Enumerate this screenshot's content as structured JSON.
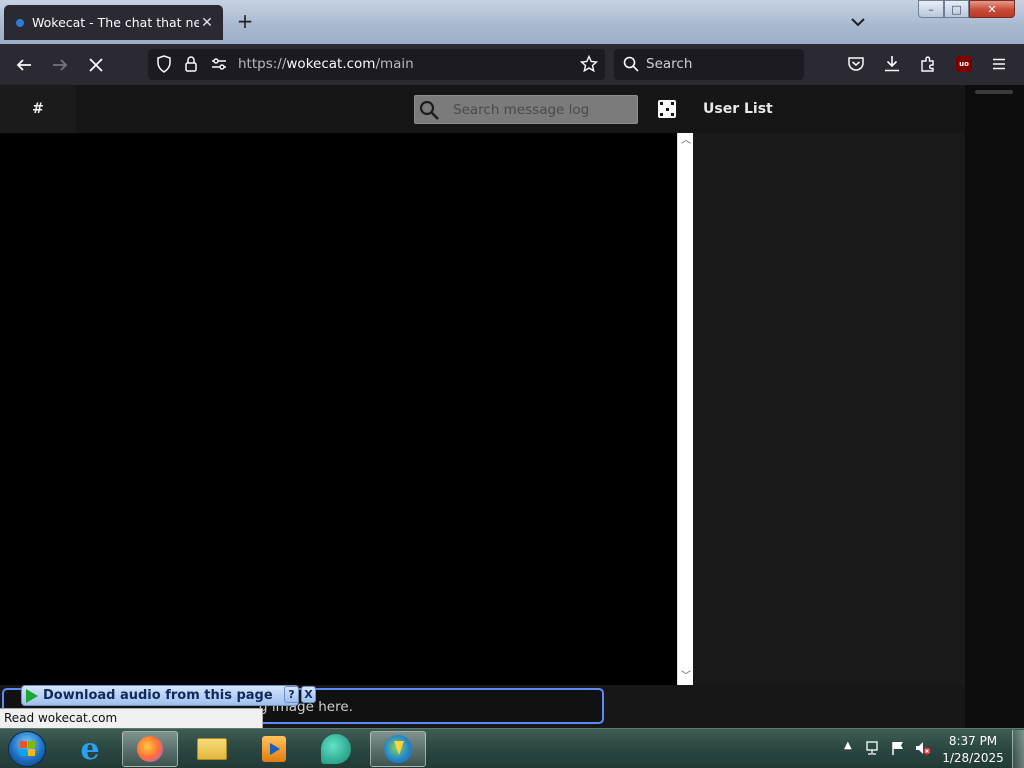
{
  "browser": {
    "tab": {
      "title": "Wokecat - The chat that never"
    },
    "url": {
      "protocol": "https://",
      "domain": "wokecat.com",
      "path": "/main"
    },
    "search_placeholder": "Search",
    "status_text": "Read wokecat.com"
  },
  "window_controls": {
    "minimize": "–",
    "maximize": "□",
    "close": "✕"
  },
  "app": {
    "channel_symbol": "#",
    "message_search_placeholder": "Search message log",
    "user_list_title": "User List",
    "message_input_placeholder": "g image here."
  },
  "download_helper": {
    "label": "Download audio from this page",
    "help": "?",
    "close": "X"
  },
  "taskbar": {
    "time": "8:37 PM",
    "date": "1/28/2025"
  },
  "colors": {
    "browser_chrome": "#2b2a33",
    "input_focus": "#5a8cff",
    "taskbar": "#2b4742"
  }
}
